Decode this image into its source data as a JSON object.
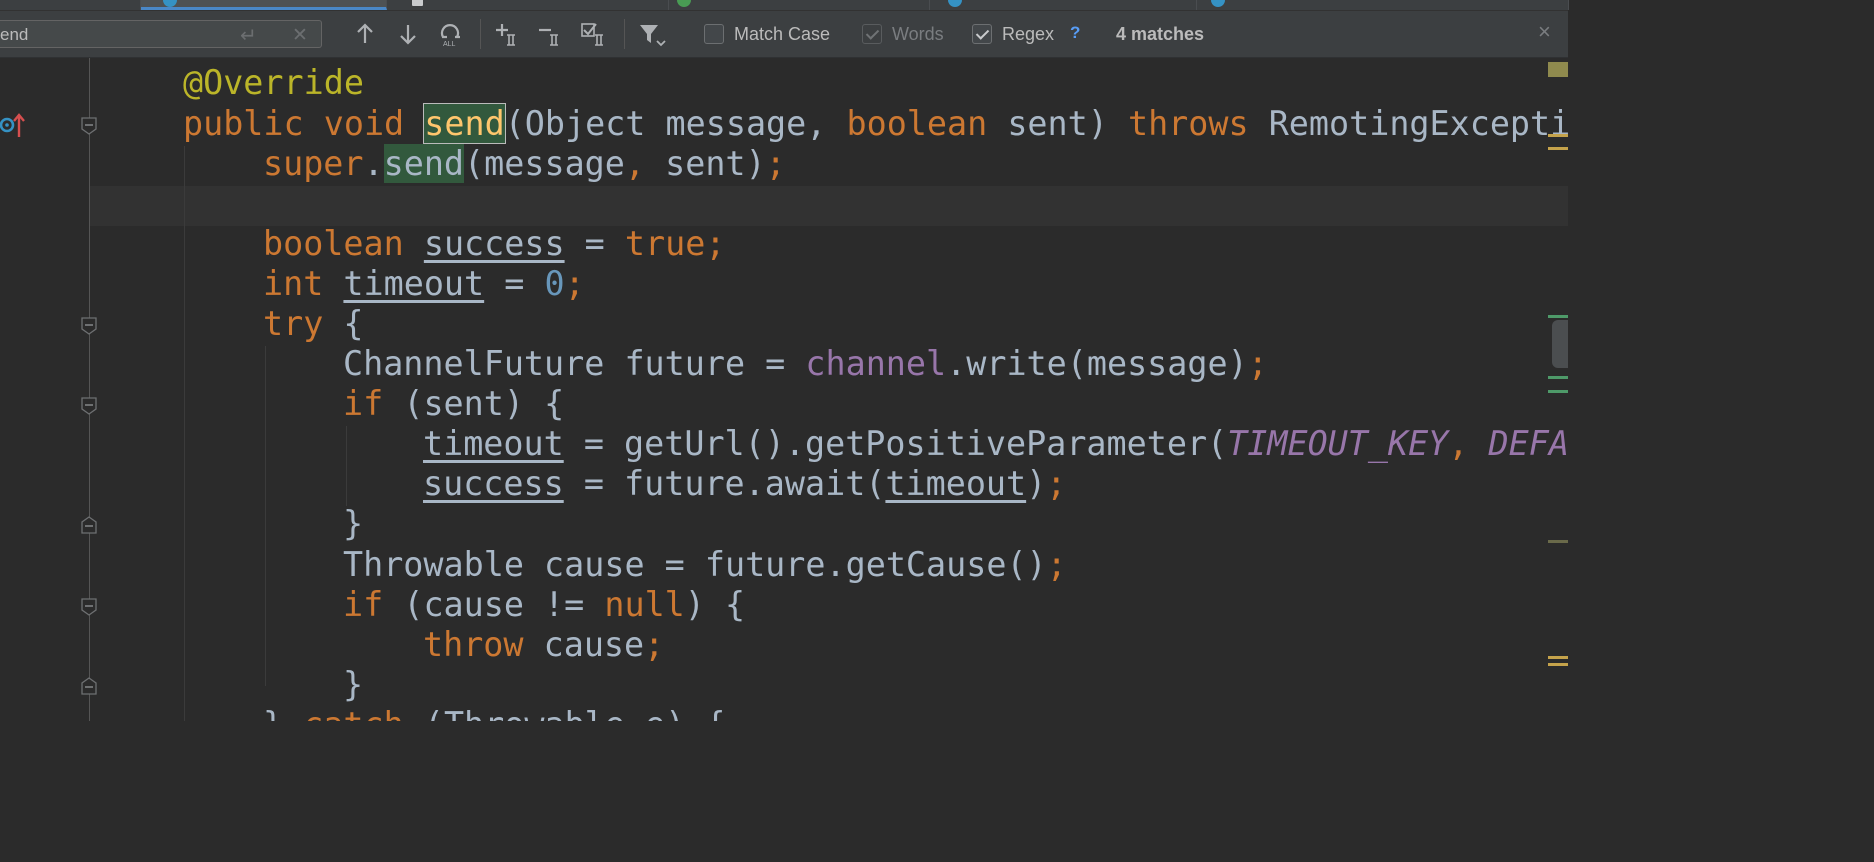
{
  "search": {
    "query": "end",
    "enter_icon": "return-arrow-icon",
    "clear_icon": "clear-icon"
  },
  "toolbar": {
    "icons": [
      "previous-occurrence-icon",
      "next-occurrence-icon",
      "select-all-occurrences-icon",
      "add-occurrence-icon",
      "remove-occurrence-icon",
      "toggle-select-occurrence-icon",
      "filter-icon"
    ]
  },
  "options": {
    "match_case": {
      "label": "Match Case",
      "checked": false
    },
    "words": {
      "label": "Words",
      "checked": true,
      "enabled": false
    },
    "regex": {
      "label": "Regex",
      "checked": true
    },
    "help": "?"
  },
  "status": {
    "matches": "4 matches"
  },
  "close_symbol": "×",
  "code_text": {
    "kw_public": "public",
    "kw_void": "void",
    "kw_boolean": "boolean",
    "kw_throws": "throws",
    "kw_super": "super",
    "kw_true": "true",
    "kw_int": "int",
    "kw_try": "try",
    "kw_if": "if",
    "kw_null": "null",
    "kw_throw": "throw",
    "kw_catch": "catch",
    "annotation": "@Override",
    "method_send": "send",
    "var_success": "success",
    "var_timeout": "timeout",
    "var_sent": "sent",
    "var_cause": "cause",
    "var_future": "future",
    "var_message": "message",
    "num_zero": "0",
    "field_channel": "channel",
    "const_timeout_key": "TIMEOUT_KEY",
    "const_default": "DEFA",
    "type_object": "Object",
    "type_remoting_ex": "RemotingExcepti",
    "type_channel_future": "ChannelFuture",
    "type_throwable": "Throwable",
    "call_write": "write",
    "call_get_url": "getUrl",
    "call_get_positive_parameter": "getPositiveParameter",
    "call_await": "await",
    "call_get_cause": "getCause",
    "param_e": "e"
  },
  "colors": {
    "keyword": "#cc7832",
    "annotation": "#bbb529",
    "number": "#6897bb",
    "field": "#9876aa",
    "text": "#a9b7c6",
    "match_highlight": "#32593d",
    "background": "#2b2b2b"
  },
  "gutter_icons": [
    "implements-method-icon",
    "overrides-method-icon"
  ]
}
